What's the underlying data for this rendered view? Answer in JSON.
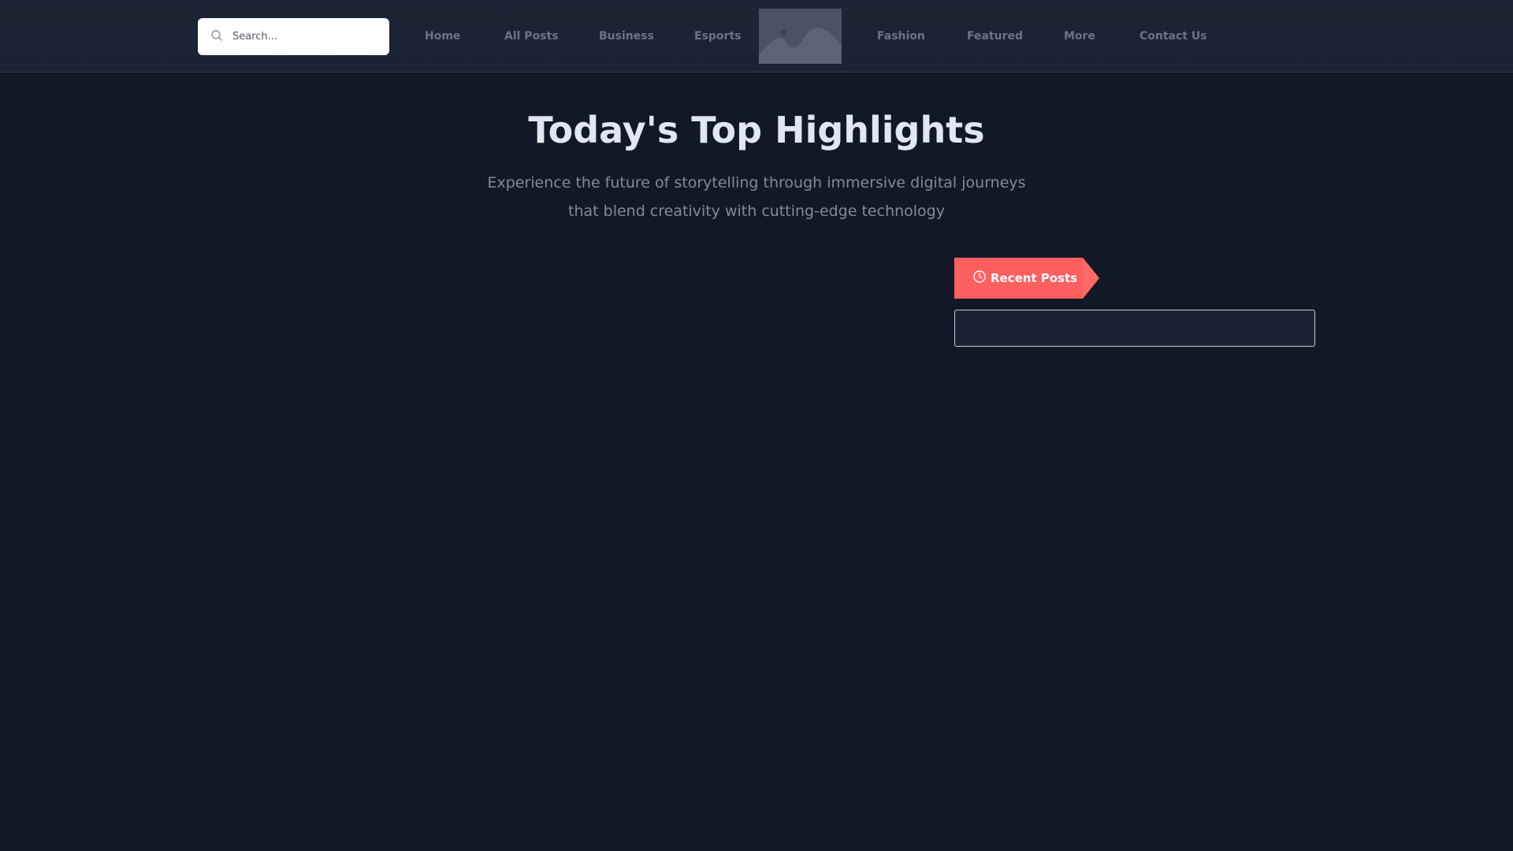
{
  "header": {
    "search": {
      "placeholder": "Search..."
    },
    "nav": {
      "items": [
        {
          "label": "Home"
        },
        {
          "label": "All Posts"
        },
        {
          "label": "Business"
        },
        {
          "label": "Esports"
        },
        {
          "label": "Fashion"
        },
        {
          "label": "Featured"
        },
        {
          "label": "More"
        },
        {
          "label": "Contact Us"
        }
      ],
      "logo_icon": "image-placeholder-icon"
    }
  },
  "hero": {
    "title": "Today's Top Highlights",
    "subtitle": "Experience the future of storytelling through immersive digital journeys that blend creativity with cutting-edge technology"
  },
  "sidebar": {
    "recent_posts": {
      "label": "Recent Posts",
      "icon": "clock-icon"
    }
  },
  "colors": {
    "page_background": "#121827",
    "header_background": "#1c2535",
    "accent": "#ff5f5f",
    "nav_text": "#6b7486",
    "title_text": "#e2e6f0",
    "subtitle_text": "#838a99"
  }
}
